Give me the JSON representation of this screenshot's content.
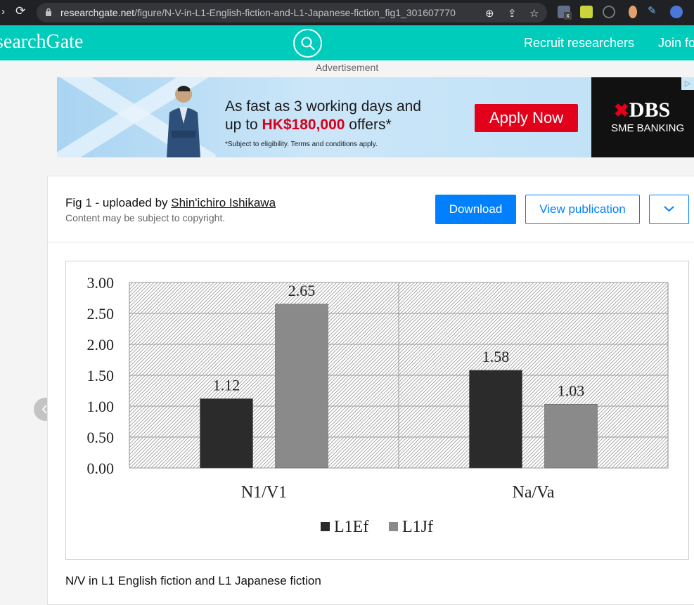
{
  "browser": {
    "url_domain": "researchgate.net",
    "url_path": "/figure/N-V-in-L1-English-fiction-and-L1-Japanese-fiction_fig1_301607770",
    "ext_badge": "x"
  },
  "header": {
    "logo": "searchGate",
    "recruit": "Recruit researchers",
    "join": "Join fo"
  },
  "ad": {
    "label": "Advertisement",
    "line1": "As fast as 3 working days and",
    "line2_pre": "up to ",
    "line2_amount": "HK$180,000",
    "line2_post": " offers*",
    "fine": "*Subject to eligibility. Terms and conditions apply.",
    "cta": "Apply Now",
    "brand": "DBS",
    "brand_sub": "SME BANKING"
  },
  "figure": {
    "title_prefix": "Fig 1 - uploaded by ",
    "author": "Shin'ichiro Ishikawa",
    "copyright": "Content may be subject to copyright.",
    "download": "Download",
    "view_publication": "View publication",
    "caption": "N/V in L1 English fiction and L1 Japanese fiction"
  },
  "chart_data": {
    "type": "bar",
    "categories": [
      "N1/V1",
      "Na/Va"
    ],
    "series": [
      {
        "name": "L1Ef",
        "values": [
          1.12,
          1.58
        ],
        "color": "#2b2b2b"
      },
      {
        "name": "L1Jf",
        "values": [
          2.65,
          1.03
        ],
        "color": "#8a8a8a"
      }
    ],
    "ylim": [
      0,
      3
    ],
    "yticks": [
      "0.00",
      "0.50",
      "1.00",
      "1.50",
      "2.00",
      "2.50",
      "3.00"
    ],
    "value_labels": [
      [
        "1.12",
        "1.58"
      ],
      [
        "2.65",
        "1.03"
      ]
    ],
    "grid": true,
    "legend_position": "bottom"
  }
}
